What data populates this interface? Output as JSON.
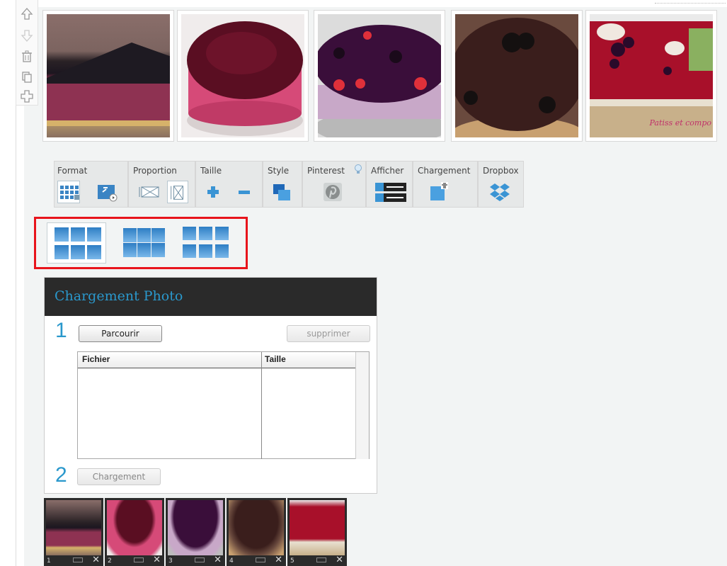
{
  "side_tools": [
    {
      "icon": "arrow-up-icon"
    },
    {
      "icon": "arrow-down-icon"
    },
    {
      "icon": "trash-icon"
    },
    {
      "icon": "copy-icon"
    },
    {
      "icon": "add-icon"
    }
  ],
  "photos": [
    {
      "caption": ""
    },
    {
      "caption": ""
    },
    {
      "caption": ""
    },
    {
      "caption": ""
    },
    {
      "caption": "Patiss et compo"
    }
  ],
  "toolbar": {
    "format": "Format",
    "proportion": "Proportion",
    "taille": "Taille",
    "style": "Style",
    "pinterest": "Pinterest",
    "afficher": "Afficher",
    "chargement": "Chargement",
    "dropbox": "Dropbox"
  },
  "upload": {
    "title": "Chargement Photo",
    "step1": "1",
    "step2": "2",
    "browse": "Parcourir",
    "delete": "supprimer",
    "upload": "Chargement",
    "col_file": "Fichier",
    "col_size": "Taille"
  },
  "thumbs": [
    {
      "num": "1"
    },
    {
      "num": "2"
    },
    {
      "num": "3"
    },
    {
      "num": "4"
    },
    {
      "num": "5"
    }
  ],
  "colors": {
    "accent": "#2a98cc",
    "highlight": "#e8141c"
  }
}
